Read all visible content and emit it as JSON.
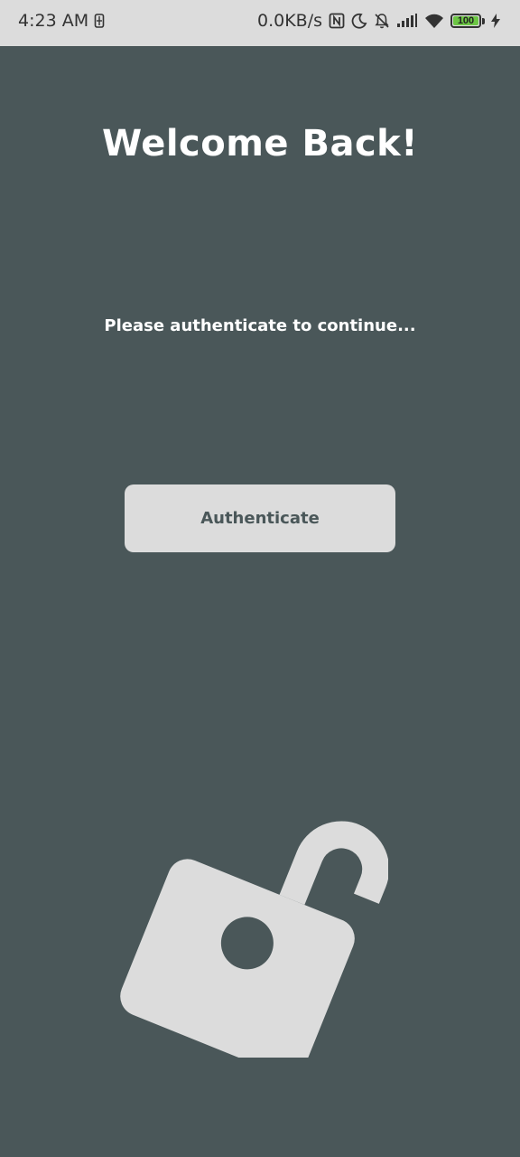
{
  "status_bar": {
    "time": "4:23 AM",
    "network_speed": "0.0KB/s",
    "battery_level": "100",
    "battery_fraction": 1.0,
    "icons": [
      "sim-icon",
      "nfc-icon",
      "moon-icon",
      "bell-off-icon",
      "signal-icon",
      "wifi-icon",
      "battery-icon",
      "charging-icon"
    ]
  },
  "screen": {
    "title": "Welcome Back!",
    "subtitle": "Please authenticate to continue...",
    "button_label": "Authenticate",
    "illustration": "unlocked-padlock-icon"
  },
  "colors": {
    "background": "#4a5759",
    "light": "#dcdcdc",
    "text": "#ffffff",
    "battery_green": "#6cc644"
  }
}
